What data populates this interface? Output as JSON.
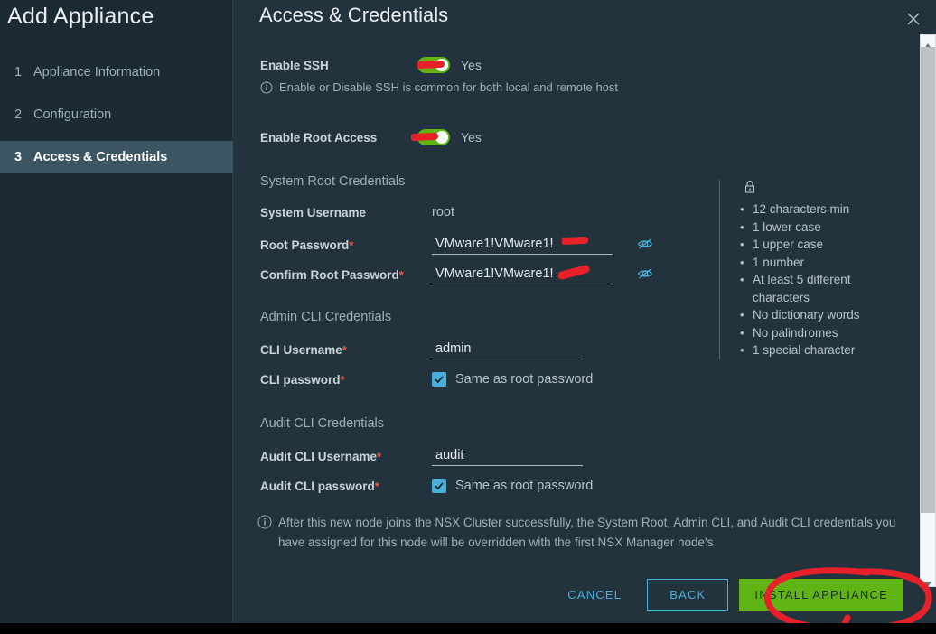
{
  "window": {
    "wizard_title": "Add Appliance",
    "pane_title": "Access & Credentials",
    "close_icon": "close-icon"
  },
  "sidebar": {
    "steps": [
      {
        "num": "1",
        "label": "Appliance Information",
        "active": false
      },
      {
        "num": "2",
        "label": "Configuration",
        "active": false
      },
      {
        "num": "3",
        "label": "Access & Credentials",
        "active": true
      }
    ]
  },
  "form": {
    "enable_ssh": {
      "label": "Enable SSH",
      "value": "Yes",
      "hint_icon": "info-icon",
      "hint": "Enable or Disable SSH is common for both local and remote host"
    },
    "enable_root_access": {
      "label": "Enable Root Access",
      "value": "Yes"
    },
    "system_root_section": "System Root Credentials",
    "system_username": {
      "label": "System Username",
      "value": "root"
    },
    "root_password": {
      "label": "Root Password",
      "required": "*",
      "value": "VMware1!VMware1!",
      "reveal_icon": "eye-off-icon"
    },
    "confirm_root_password": {
      "label": "Confirm Root Password",
      "required": "*",
      "value": "VMware1!VMware1!",
      "reveal_icon": "eye-off-icon"
    },
    "admin_cli_section": "Admin CLI Credentials",
    "cli_username": {
      "label": "CLI Username",
      "required": "*",
      "value": "admin"
    },
    "cli_password": {
      "label": "CLI password",
      "required": "*",
      "checkbox_label": "Same as root password",
      "checked": true
    },
    "audit_cli_section": "Audit CLI Credentials",
    "audit_cli_username": {
      "label": "Audit CLI Username",
      "required": "*",
      "value": "audit"
    },
    "audit_cli_password": {
      "label": "Audit CLI password",
      "required": "*",
      "checkbox_label": "Same as root password",
      "checked": true
    },
    "footer_note": {
      "icon": "info-icon",
      "line1": "After this new node joins the NSX Cluster successfully, the System Root, Admin CLI, and Audit CLI",
      "line2": "credentials you have assigned for this node will be overridden with the first NSX Manager node's"
    }
  },
  "password_requirements": {
    "icon": "lock-icon",
    "items": [
      "12 characters min",
      "1 lower case",
      "1 upper case",
      "1 number",
      "At least 5 different characters",
      "No dictionary words",
      "No palindromes",
      "1 special character"
    ]
  },
  "footer": {
    "cancel_label": "CANCEL",
    "back_label": "BACK",
    "install_label": "INSTALL APPLIANCE"
  },
  "colors": {
    "accent_blue": "#49afd9",
    "toggle_green": "#60b515",
    "required_red": "#e8584b",
    "annotation_red": "#e8202a",
    "sidebar_bg": "#1b2a33",
    "content_bg": "#22333d",
    "active_step_bg": "#3b5562"
  },
  "annotations": {
    "marks": "red-highlighter-marks",
    "circle": "red-circle-around-install-appliance"
  }
}
